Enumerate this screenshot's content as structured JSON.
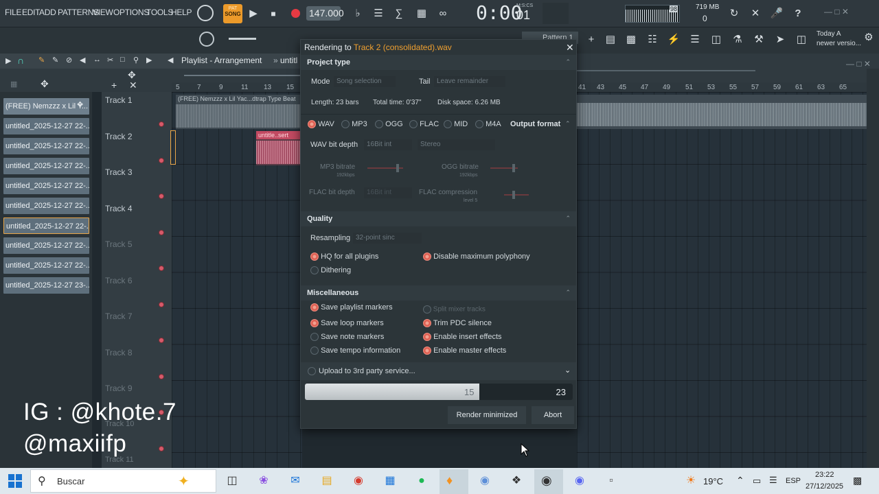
{
  "menu": {
    "file": "FILE",
    "edit": "EDIT",
    "add": "ADD",
    "patterns": "PATTERNS",
    "view": "VIEW",
    "options": "OPTIONS",
    "tools": "TOOLS",
    "help": "HELP"
  },
  "transport": {
    "pat": "PAT",
    "song": "SONG",
    "tempo": "147.000",
    "time": "0:00",
    "time_small": "01",
    "time_label": "M:S:CS"
  },
  "perf": {
    "memory": "719 MB",
    "voices": "0",
    "cpu": "98"
  },
  "hint": {
    "line1": "Today  A",
    "line2": "newer versio..."
  },
  "pattern_label": "Pattern 1",
  "playlist": {
    "title": "Playlist - Arrangement",
    "crumb": "untitl"
  },
  "patterns": [
    "(FREE) Nemzzz x Lil Y...",
    "untitled_2025-12-27 22-...",
    "untitled_2025-12-27 22-...",
    "untitled_2025-12-27 22-...",
    "untitled_2025-12-27 22-...",
    "untitled_2025-12-27 22-...",
    "untitled_2025-12-27 22-...",
    "untitled_2025-12-27 22-...",
    "untitled_2025-12-27 22-...",
    "untitled_2025-12-27 23-..."
  ],
  "tracks": [
    "Track 1",
    "Track 2",
    "Track 3",
    "Track 4",
    "Track 5",
    "Track 6",
    "Track 7",
    "Track 8",
    "Track 9",
    "Track 10",
    "Track 11"
  ],
  "clips": {
    "track1": "(FREE) Nemzzz x Lil Yac...dtrap Type Beat",
    "track2": "untitle..sert"
  },
  "ruler_left": [
    "5",
    "7",
    "9",
    "11",
    "13",
    "15"
  ],
  "ruler_right": [
    "41",
    "43",
    "45",
    "47",
    "49",
    "51",
    "53",
    "55",
    "57",
    "59",
    "61",
    "63",
    "65"
  ],
  "dialog": {
    "title_prefix": "Rendering to ",
    "title_file": "Track 2 (consolidated).wav",
    "project_type": "Project type",
    "mode_label": "Mode",
    "mode_value": "Song selection",
    "tail_label": "Tail",
    "tail_value": "Leave remainder",
    "length": "Length: 23 bars",
    "total_time": "Total time: 0'37\"",
    "disk_space": "Disk space: 6.26 MB",
    "formats": [
      "WAV",
      "MP3",
      "OGG",
      "FLAC",
      "MID",
      "M4A"
    ],
    "output_format": "Output format",
    "wav_bitdepth_label": "WAV bit depth",
    "wav_bitdepth_value": "16Bit int",
    "channels_value": "Stereo",
    "mp3_bitrate": "MP3 bitrate",
    "mp3_bitrate_value": "192kbps",
    "ogg_bitrate": "OGG bitrate",
    "ogg_bitrate_value": "192kbps",
    "flac_bitdepth": "FLAC bit depth",
    "flac_bitdepth_value": "16Bit int",
    "flac_compression": "FLAC compression",
    "flac_compression_value": "level 5",
    "quality": "Quality",
    "resampling_label": "Resampling",
    "resampling_value": "32-point sinc",
    "hq_plugins": "HQ for all plugins",
    "disable_poly": "Disable maximum polyphony",
    "dithering": "Dithering",
    "misc": "Miscellaneous",
    "save_playlist_markers": "Save playlist markers",
    "split_mixer": "Split mixer tracks",
    "save_loop_markers": "Save loop markers",
    "trim_pdc": "Trim PDC silence",
    "save_note_markers": "Save note markers",
    "enable_insert": "Enable insert effects",
    "save_tempo": "Save tempo information",
    "enable_master": "Enable master effects",
    "upload": "Upload to 3rd party service...",
    "progress_current": "15",
    "progress_total": "23",
    "progress_fraction": 0.652,
    "render_minimized": "Render minimized",
    "abort": "Abort"
  },
  "watermark": {
    "line1": "IG : @khote.7",
    "line2": "@maxiifp"
  },
  "taskbar": {
    "search": "Buscar",
    "temp": "19°C",
    "lang": "ESP",
    "time": "23:22",
    "date": "27/12/2025"
  },
  "colors": {
    "accent": "#e9a648",
    "radio_on": "#de5f52",
    "title_file": "#f0a030"
  }
}
